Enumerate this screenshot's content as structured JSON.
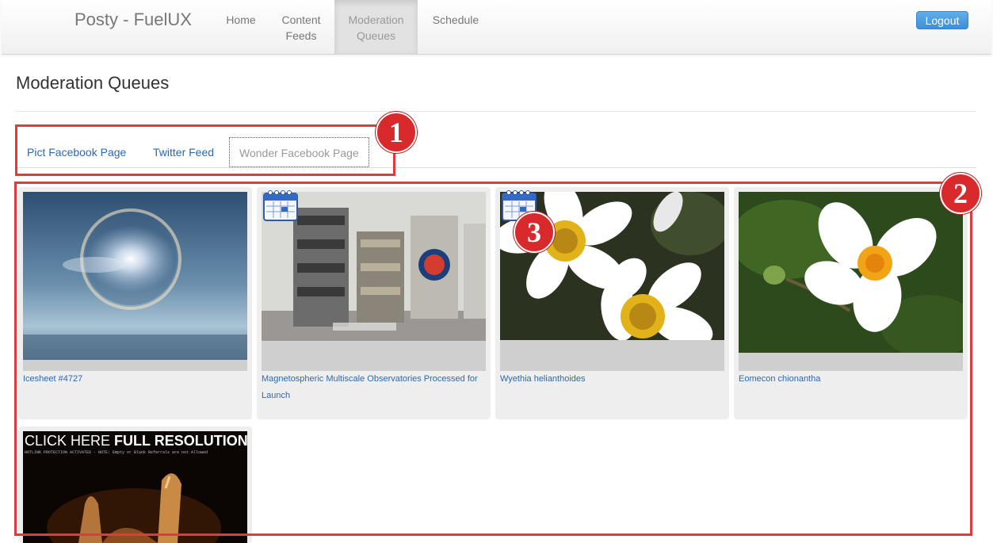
{
  "nav": {
    "brand": "Posty - FuelUX",
    "items": [
      {
        "line1": "Home",
        "line2": ""
      },
      {
        "line1": "Content",
        "line2": "Feeds"
      },
      {
        "line1": "Moderation",
        "line2": "Queues"
      },
      {
        "line1": "Schedule",
        "line2": ""
      }
    ],
    "logout_label": "Logout"
  },
  "page": {
    "title": "Moderation Queues"
  },
  "tabs": [
    "Pict Facebook Page",
    "Twitter Feed",
    "Wonder Facebook Page"
  ],
  "active_tab": "Wonder Facebook Page",
  "annotations": [
    "1",
    "2",
    "3"
  ],
  "cards": [
    {
      "caption": "Icesheet #4727",
      "image": "halo-over-ice-image",
      "scheduled": false
    },
    {
      "caption": "Magnetospheric Multiscale Observatories Processed for Launch",
      "image": "spacecraft-assembly-image",
      "scheduled": true
    },
    {
      "caption": "Wyethia helianthoides",
      "image": "white-daisies-image",
      "scheduled": true
    },
    {
      "caption": "Eomecon chionantha",
      "image": "white-flower-image",
      "scheduled": false
    },
    {
      "caption": "",
      "image": "dark-hand-image",
      "scheduled": false,
      "overlay_title_a": "CLICK HERE",
      "overlay_title_b": "FULL RESOLUTION",
      "overlay_note": "HOTLINK PROTECTION ACTIVATED - NOTE: Empty or Blank Referrals are not Allowed"
    }
  ],
  "colors": {
    "link": "#2a6ab0",
    "highlight": "#e0393e",
    "badge": "#d8292d",
    "logout": "#3d8fd6"
  }
}
